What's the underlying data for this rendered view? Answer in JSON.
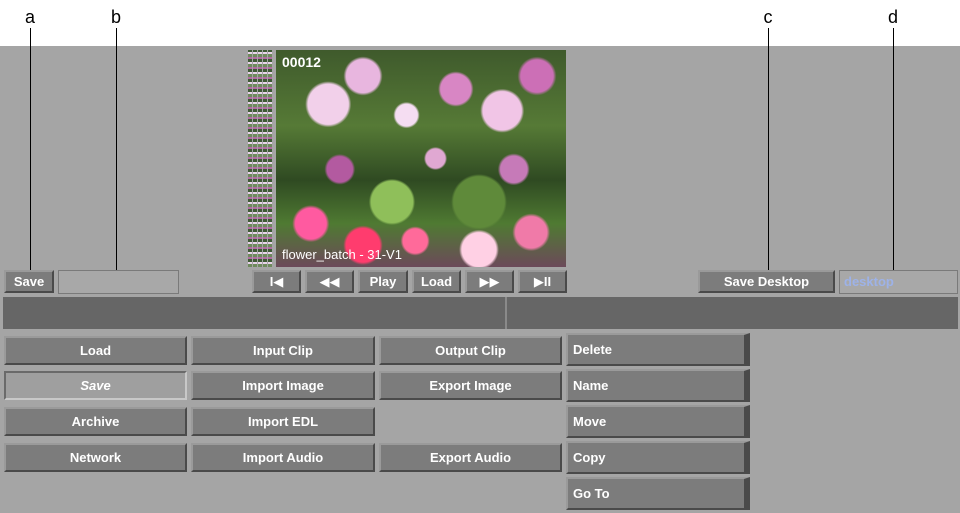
{
  "callouts": {
    "a": "a",
    "b": "b",
    "c": "c",
    "d": "d"
  },
  "preview": {
    "frame_number": "00012",
    "clip_name": "flower_batch - 31-V1"
  },
  "transport": {
    "first_label": "I◀",
    "rewind_label": "◀◀",
    "play_label": "Play",
    "load_label": "Load",
    "forward_label": "▶▶",
    "last_label": "▶II"
  },
  "top_left": {
    "save_label": "Save",
    "name_value": ""
  },
  "top_right": {
    "save_desktop_label": "Save Desktop",
    "desktop_value": "desktop"
  },
  "menu": {
    "col1": [
      "Load",
      "Save",
      "Archive",
      "Network"
    ],
    "col2": [
      "Input Clip",
      "Import Image",
      "Import EDL",
      "Import Audio"
    ],
    "col3": [
      "Output Clip",
      "Export Image",
      "Export Audio"
    ],
    "col4": [
      "Delete",
      "Name",
      "Move",
      "Copy",
      "Go To"
    ]
  },
  "colors": {
    "panel": "#a5a5a5",
    "button": "#7c7c7c",
    "status_bar": "#666666",
    "desktop_text": "#9db2e8"
  }
}
